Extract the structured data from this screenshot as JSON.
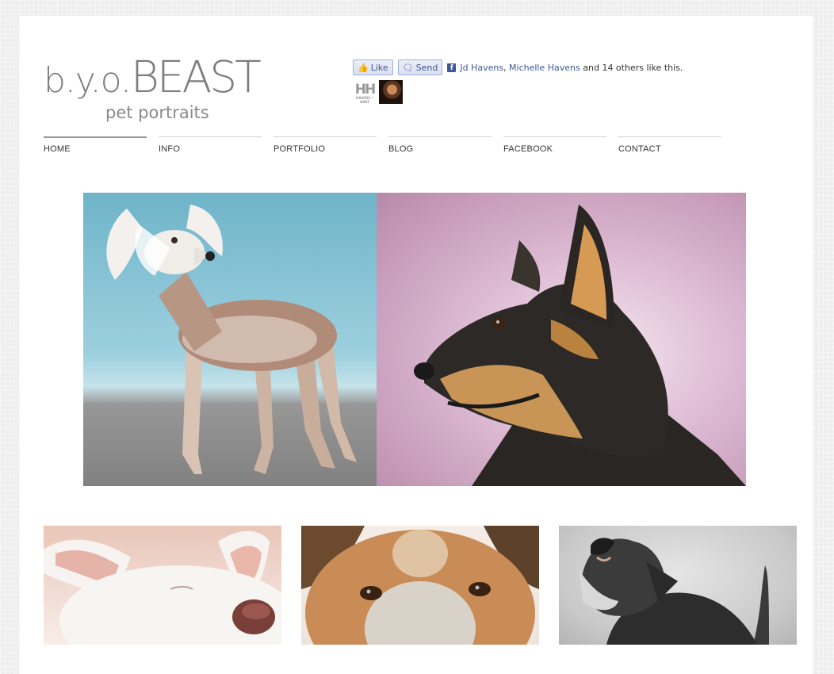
{
  "logo": {
    "small": "b.y.o.",
    "big": "BEAST",
    "subtitle": "pet portraits"
  },
  "facebook": {
    "like_label": "Like",
    "send_label": "Send",
    "friend1": "Jd Havens",
    "comma": ",",
    "friend2": "Michelle Havens",
    "others_text": "and 14 others like this.",
    "face1_text": "HH",
    "face1_caption": "HAVENS • HART"
  },
  "nav": {
    "items": [
      {
        "label": "HOME",
        "active": true
      },
      {
        "label": "INFO"
      },
      {
        "label": "PORTFOLIO"
      },
      {
        "label": "BLOG"
      },
      {
        "label": "FACEBOOK"
      },
      {
        "label": "CONTACT"
      }
    ]
  },
  "colors": {
    "background": "#eeeeee",
    "page": "#ffffff",
    "logo": "#7d7d7d",
    "fb_link": "#3b5998"
  }
}
